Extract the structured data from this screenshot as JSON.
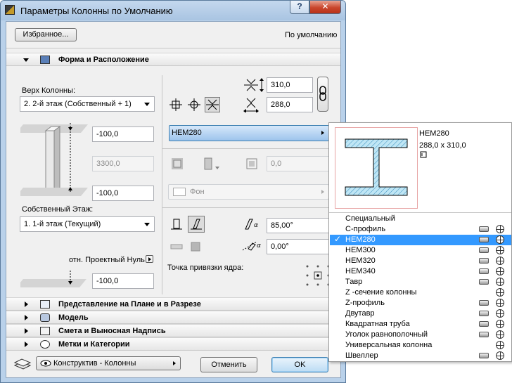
{
  "window": {
    "title": "Параметры Колонны по Умолчанию",
    "help_label": "?",
    "close_label": "✕"
  },
  "top": {
    "favorites_label": "Избранное...",
    "default_label": "По умолчанию"
  },
  "sections": {
    "shape": "Форма и Расположение",
    "plan": "Представление на Плане и в Разрезе",
    "model": "Модель",
    "listing": "Смета и Выносная Надпись",
    "tags": "Метки и Категории"
  },
  "left": {
    "top_label": "Верх Колонны:",
    "top_value": "2. 2-й этаж (Собственный + 1)",
    "offset_top": "-100,0",
    "height": "3300,0",
    "offset_bottom": "-100,0",
    "home_label": "Собственный Этаж:",
    "home_value": "1. 1-й этаж (Текущий)",
    "relative_label": "отн. Проектный Нуль",
    "relative_value": "-100,0"
  },
  "right": {
    "width": "310,0",
    "depth": "288,0",
    "profile": "HEM280",
    "veneer_thickness": "0,0",
    "fill_label": "Фон",
    "angle1": "85,00°",
    "angle2": "0,00°",
    "anchor_label": "Точка привязки ядра:"
  },
  "bottom": {
    "layer": "Конструктив - Колонны",
    "cancel_label": "Отменить",
    "ok_label": "OK"
  },
  "popup": {
    "name": "HEM280",
    "dimensions": "288,0 x 310,0",
    "items": [
      {
        "label": "Специальный",
        "selected": false,
        "icons": false
      },
      {
        "label": "С-профиль",
        "selected": false,
        "icons": true
      },
      {
        "label": "HEM280",
        "selected": true,
        "icons": true
      },
      {
        "label": "HEM300",
        "selected": false,
        "icons": true
      },
      {
        "label": "HEM320",
        "selected": false,
        "icons": true
      },
      {
        "label": "HEM340",
        "selected": false,
        "icons": true
      },
      {
        "label": "Тавр",
        "selected": false,
        "icons": true
      },
      {
        "label": "Z -сечение колонны",
        "selected": false,
        "icons": "b"
      },
      {
        "label": "Z-профиль",
        "selected": false,
        "icons": true
      },
      {
        "label": "Двутавр",
        "selected": false,
        "icons": true
      },
      {
        "label": "Квадратная труба",
        "selected": false,
        "icons": true
      },
      {
        "label": "Уголок равнополочный",
        "selected": false,
        "icons": true
      },
      {
        "label": "Универсальная колонна",
        "selected": false,
        "icons": "b"
      },
      {
        "label": "Швеллер",
        "selected": false,
        "icons": true
      }
    ]
  },
  "colors": {
    "selection": "#3399ff",
    "profile_button": "#9dc4ec",
    "ok_border": "#3c7fb1"
  }
}
